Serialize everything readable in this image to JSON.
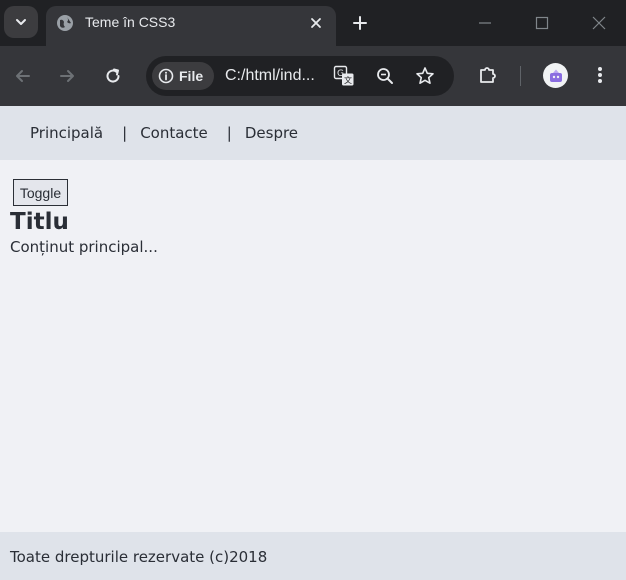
{
  "browser": {
    "tab": {
      "title": "Teme în CSS3"
    },
    "address_bar": {
      "scheme_label": "File",
      "url": "C:/html/ind..."
    }
  },
  "page": {
    "nav": {
      "items": [
        "Principală",
        "Contacte",
        "Despre"
      ],
      "separator": "|"
    },
    "toggle_label": "Toggle",
    "title": "Titlu",
    "content": "Conținut principal...",
    "footer": "Toate drepturile rezervate (c)2018"
  }
}
